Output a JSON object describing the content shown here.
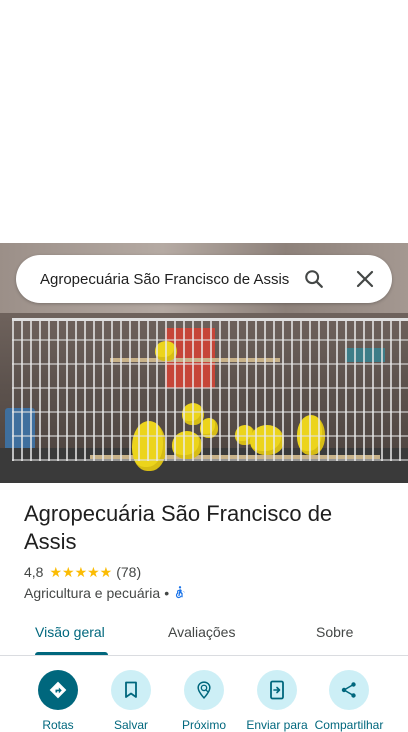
{
  "search": {
    "query": "Agropecuária São Francisco de Assis"
  },
  "icons": {
    "search": "search-icon",
    "close": "close-icon",
    "directions": "directions-icon",
    "save": "bookmark-icon",
    "nearby": "nearby-icon",
    "send": "send-to-phone-icon",
    "share": "share-icon",
    "accessibility": "wheelchair-icon"
  },
  "place": {
    "title": "Agropecuária São Francisco de Assis",
    "rating": "4,8",
    "stars": "★★★★★",
    "reviews_count": "(78)",
    "category": "Agricultura e pecuária",
    "separator": "•"
  },
  "tabs": [
    {
      "label": "Visão geral",
      "active": true
    },
    {
      "label": "Avaliações",
      "active": false
    },
    {
      "label": "Sobre",
      "active": false
    }
  ],
  "actions": [
    {
      "label": "Rotas"
    },
    {
      "label": "Salvar"
    },
    {
      "label": "Próximo"
    },
    {
      "label": "Enviar para"
    },
    {
      "label": "Compartilhar"
    }
  ],
  "colors": {
    "accent": "#00677d",
    "accent_light": "#cdeff6",
    "star": "#fbbc04",
    "accessibility": "#1a73e8"
  }
}
